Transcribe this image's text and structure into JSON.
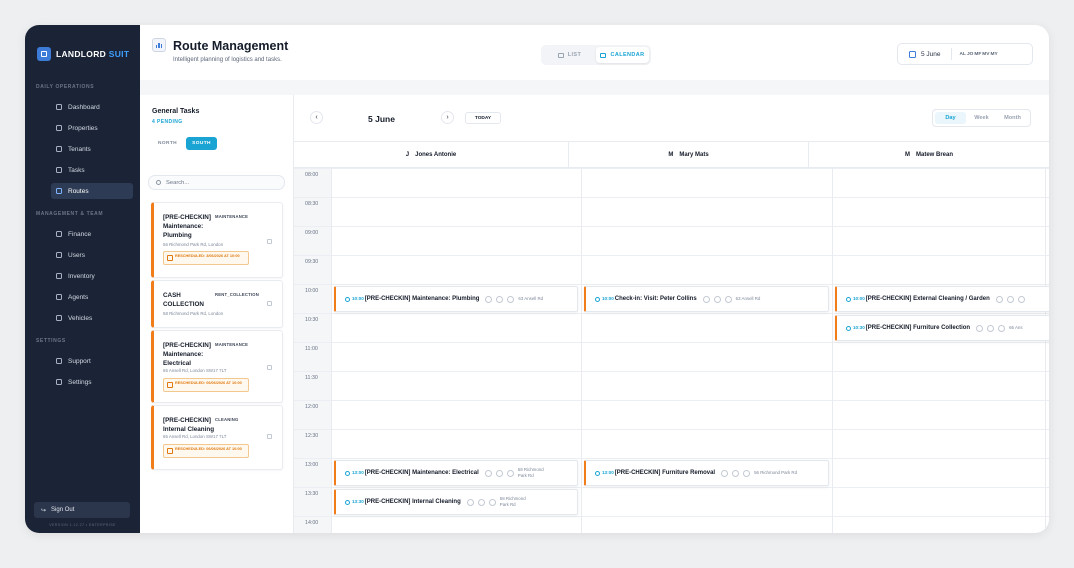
{
  "brand": {
    "name": "LANDLORD",
    "suffix": "SUIT"
  },
  "sidebar": {
    "sections": [
      "DAILY OPERATIONS",
      "MANAGEMENT & TEAM",
      "SETTINGS"
    ],
    "items": [
      {
        "label": "Dashboard",
        "icon": "dashboard-icon"
      },
      {
        "label": "Properties",
        "icon": "building-icon"
      },
      {
        "label": "Tenants",
        "icon": "people-icon"
      },
      {
        "label": "Tasks",
        "icon": "clipboard-icon"
      },
      {
        "label": "Routes",
        "icon": "map-icon"
      },
      {
        "label": "Finance",
        "icon": "dollar-icon"
      },
      {
        "label": "Users",
        "icon": "user-icon"
      },
      {
        "label": "Inventory",
        "icon": "box-icon"
      },
      {
        "label": "Agents",
        "icon": "agents-icon"
      },
      {
        "label": "Vehicles",
        "icon": "car-icon"
      },
      {
        "label": "Support",
        "icon": "support-icon"
      },
      {
        "label": "Settings",
        "icon": "shield-icon"
      }
    ],
    "active": "Routes",
    "signout": "Sign Out",
    "version": "VERSION 1.12.27 • ENTERPRISE"
  },
  "header": {
    "title": "Route Management",
    "subtitle": "Intelligent planning of logistics and tasks.",
    "views": [
      "LIST",
      "CALENDAR"
    ],
    "active_view": "CALENDAR",
    "date": "5 June",
    "avatars": [
      "AL",
      "JO",
      "MF",
      "MV",
      "MY"
    ]
  },
  "tasks_panel": {
    "title": "General Tasks",
    "count": "4 PENDING",
    "zones": [
      "NORTH",
      "SOUTH"
    ],
    "active_zone": "SOUTH",
    "search_placeholder": "Search...",
    "cards": [
      {
        "title": "[PRE-CHECKIN] Maintenance: Plumbing",
        "tag": "MAINTENANCE",
        "addr": "56 Richmond Park Rd, London",
        "sched": "RESCHEDULED: 3/06/2026 AT 10:00"
      },
      {
        "title": "CASH COLLECTION",
        "tag": "RENT_COLLECTION",
        "addr": "58 Richmond Park Rd, London",
        "sched": ""
      },
      {
        "title": "[PRE-CHECKIN] Maintenance: Electrical",
        "tag": "MAINTENANCE",
        "addr": "65 Ansell Rd, London SW17 7LT",
        "sched": "RESCHEDULED: 06/06/2026 AT 10:00"
      },
      {
        "title": "[PRE-CHECKIN] Internal Cleaning",
        "tag": "CLEANING",
        "addr": "65 Ansell Rd, London SW17 7LT",
        "sched": "RESCHEDULED: 06/06/2026 AT 10:00"
      }
    ]
  },
  "calendar": {
    "current_date": "5 June",
    "today": "TODAY",
    "ranges": [
      "Day",
      "Week",
      "Month"
    ],
    "active_range": "Day",
    "agents": [
      {
        "initial": "J",
        "name": "Jones Antonie"
      },
      {
        "initial": "M",
        "name": "Mary Mats"
      },
      {
        "initial": "M",
        "name": "Matew Brean"
      }
    ],
    "slots": [
      "08:00",
      "08:30",
      "09:00",
      "09:30",
      "10:00",
      "10:30",
      "11:00",
      "11:30",
      "12:00",
      "12:30",
      "13:00",
      "13:30",
      "14:00"
    ],
    "events": [
      {
        "agent": 0,
        "start": "10:00",
        "title": "[PRE-CHECKIN] Maintenance: Plumbing",
        "addr": "63 Ansell Rd"
      },
      {
        "agent": 1,
        "start": "10:00",
        "title": "Check-in: Visit: Peter Collins",
        "addr": "63 Ansell Rd"
      },
      {
        "agent": 2,
        "start": "10:00",
        "title": "[PRE-CHECKIN] External Cleaning / Garden",
        "addr": ""
      },
      {
        "agent": 2,
        "start": "10:30",
        "title": "[PRE-CHECKIN] Furniture Collection",
        "addr": "66 Ans"
      },
      {
        "agent": 0,
        "start": "13:00",
        "title": "[PRE-CHECKIN] Maintenance: Electrical",
        "addr": "58 Richmond Park Rd"
      },
      {
        "agent": 1,
        "start": "13:00",
        "title": "[PRE-CHECKIN] Furniture Removal",
        "addr": "56 Richmond Park Rd"
      },
      {
        "agent": 0,
        "start": "13:30",
        "title": "[PRE-CHECKIN] Internal Cleaning",
        "addr": "58 Richmond Park Rd"
      }
    ]
  }
}
